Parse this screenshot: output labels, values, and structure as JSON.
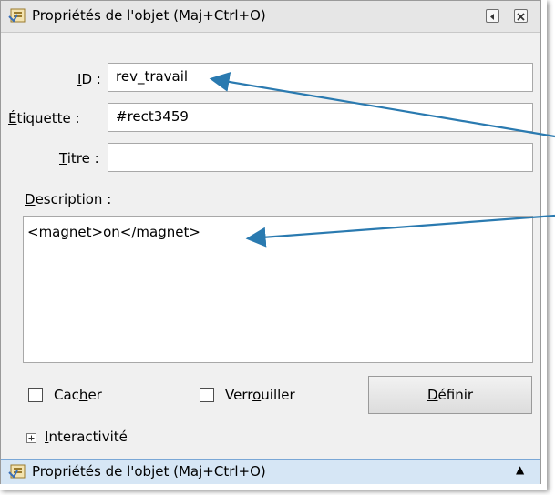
{
  "window": {
    "title": "Propriétés de l'objet (Maj+Ctrl+O)",
    "icons": [
      "object-properties-icon",
      "undock-icon",
      "close-icon"
    ]
  },
  "form": {
    "id_label_key": "I",
    "id_label_rest": "D :",
    "id_value": "rev_travail",
    "label_label_key": "É",
    "label_label_rest": "tiquette :",
    "label_value": "#rect3459",
    "title_label_key": "T",
    "title_label_rest": "itre :",
    "title_value": "",
    "description_label_key": "D",
    "description_label_rest": "escription :",
    "description_value": "<magnet>on</magnet>"
  },
  "options": {
    "hide_pre": "Cac",
    "hide_key": "h",
    "hide_post": "er",
    "lock_pre": "Verr",
    "lock_key": "o",
    "lock_post": "uiller",
    "define_key": "D",
    "define_rest": "éfinir"
  },
  "interactivity": {
    "key": "I",
    "rest": "nteractivité"
  },
  "dock": {
    "title": "Propriétés de l'objet (Maj+Ctrl+O)",
    "arrow": "▲"
  },
  "colors": {
    "annotation_arrow": "#2a7ab0",
    "dock_bar": "#d6e6f5"
  }
}
